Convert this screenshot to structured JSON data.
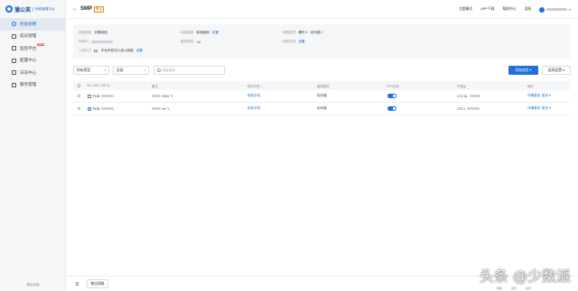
{
  "sidebar": {
    "logo_text": "蒲公英",
    "logo_sub": "网络管理平台",
    "items": [
      {
        "label": "智能组网",
        "active": true
      },
      {
        "label": "成员管理",
        "active": false
      },
      {
        "label": "监控平台",
        "active": false,
        "badge": "NEW"
      },
      {
        "label": "配置中心",
        "active": false
      },
      {
        "label": "日志中心",
        "active": false
      },
      {
        "label": "服务管理",
        "active": false
      }
    ],
    "footer": "退出旧版"
  },
  "topbar": {
    "back": "←",
    "network_name": "SMP",
    "network_tag": "默认",
    "links": [
      "主题模式",
      "APP下载",
      "帮助中心",
      "消息"
    ],
    "user_caret": "▾"
  },
  "info": {
    "network_type_label": "网络类型",
    "network_type_value": "对等网络",
    "mode_label": "网络组网",
    "mode_value": "标准组网",
    "mode_link": "设置",
    "nodes_label": "网络成员",
    "nodes_value_a": "硬件 0",
    "nodes_value_b": "访问端 2",
    "network_id_label": "网络ID",
    "subnet_label": "组网类型",
    "subnet_value": "Yd",
    "dns_label": "网络名称",
    "dns_link": "设置",
    "join_label": "入网方式",
    "join_value": "不允许任何人加入网络",
    "join_link": "设置"
  },
  "toolbar": {
    "filter_all": "所有类型",
    "filter_status": "全部",
    "search_placeholder": "快速搜索",
    "add_button": "添加成员 ▾",
    "settings_button": "组网设置 ▾"
  },
  "table": {
    "headers": [
      "SN / UID / SID ⇅",
      "备注",
      "绑定手机 / ...",
      "组网属性",
      "VPN状态",
      "IP地址",
      "操作"
    ],
    "rows": [
      {
        "id": "PGB",
        "remark": "3GN",
        "binding": "绑定手机",
        "role": "访问端",
        "vpn_on": true,
        "ip": "172.16.",
        "op_a": "详情更多",
        "op_b": "更多 ▾"
      },
      {
        "id": "PGB",
        "remark": "ed",
        "binding": "绑定手机",
        "role": "访问端",
        "vpn_on": true,
        "ip": "172.1",
        "op_a": "详情更多",
        "op_b": "更多 ▾"
      }
    ]
  },
  "bottombar": {
    "button": "移出网络"
  },
  "watermark": {
    "text": "头条 @少数派",
    "sub_a": "网络",
    "sub_b": "成员",
    "sub_c": "设置"
  }
}
